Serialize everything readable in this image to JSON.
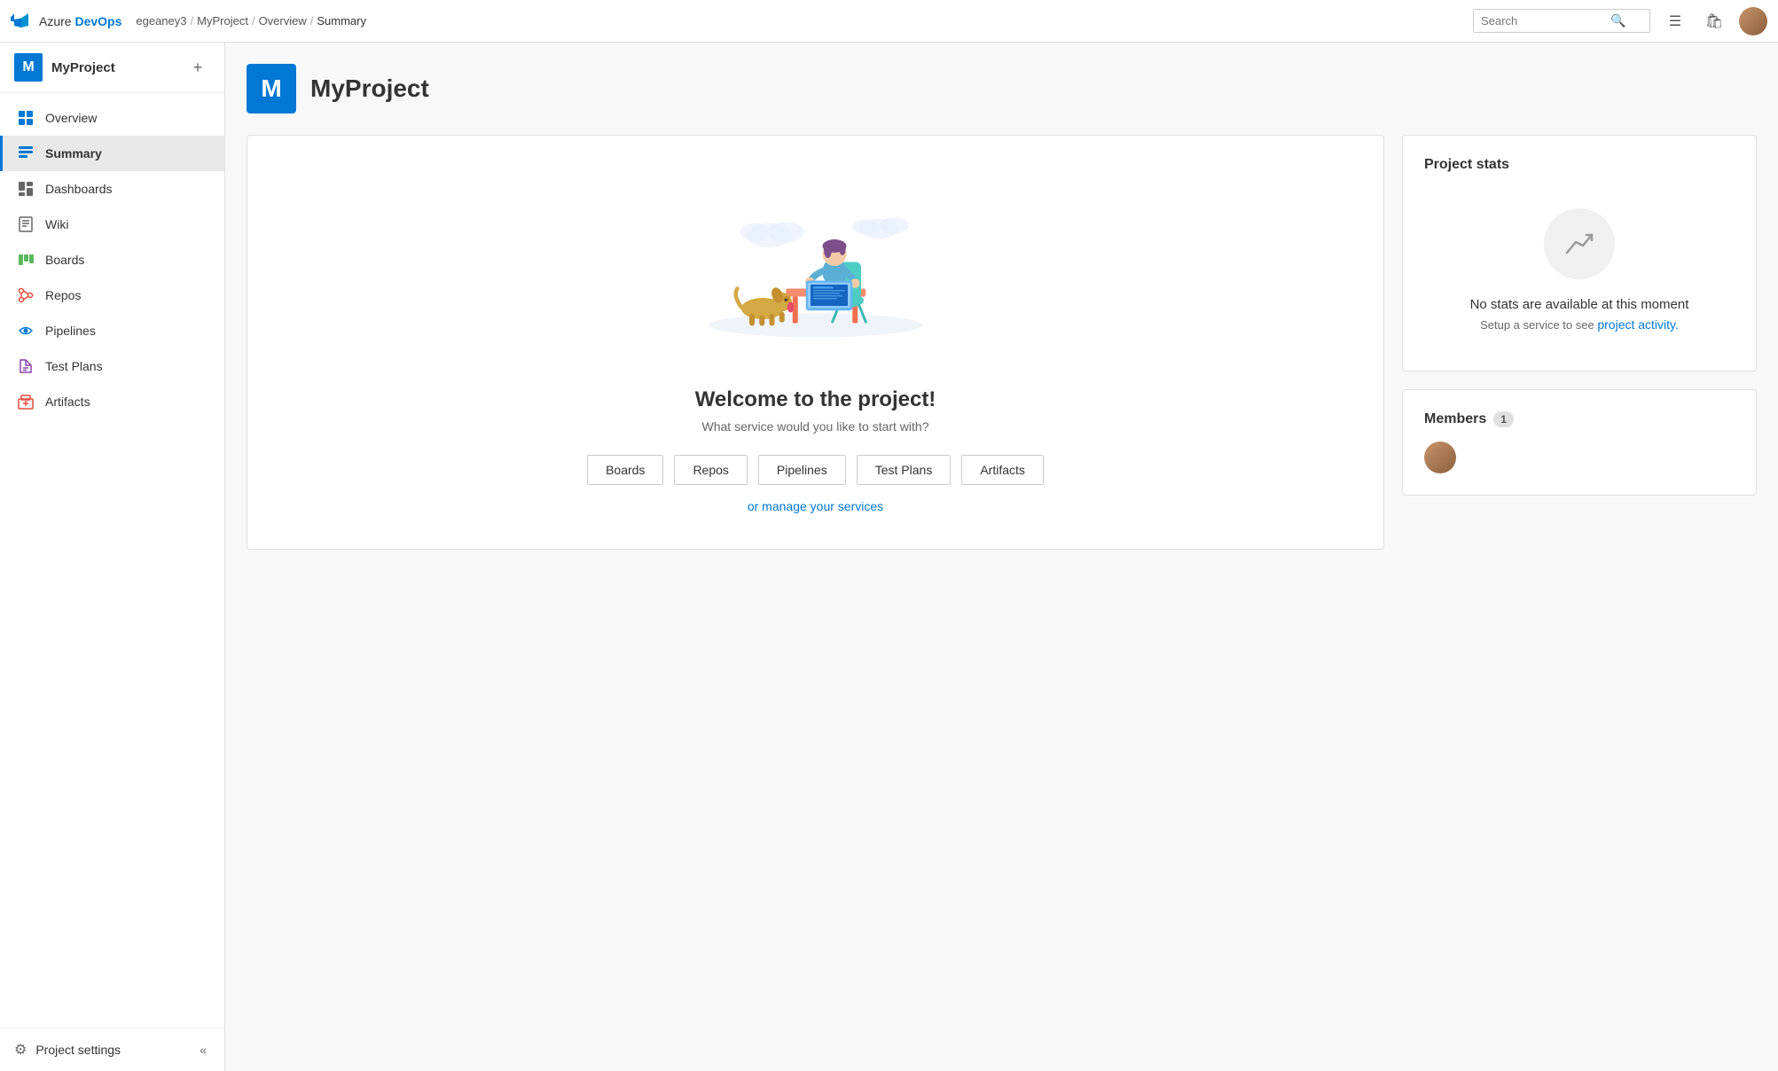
{
  "topNav": {
    "logo": {
      "text": "Azure ",
      "highlight": "DevOps"
    },
    "breadcrumb": [
      {
        "label": "egeaney3"
      },
      {
        "label": "MyProject"
      },
      {
        "label": "Overview"
      },
      {
        "label": "Summary"
      }
    ],
    "search": {
      "placeholder": "Search"
    }
  },
  "sidebar": {
    "project": {
      "initial": "M",
      "name": "MyProject"
    },
    "items": [
      {
        "id": "overview",
        "label": "Overview",
        "active": false
      },
      {
        "id": "summary",
        "label": "Summary",
        "active": true
      },
      {
        "id": "dashboards",
        "label": "Dashboards",
        "active": false
      },
      {
        "id": "wiki",
        "label": "Wiki",
        "active": false
      },
      {
        "id": "boards",
        "label": "Boards",
        "active": false
      },
      {
        "id": "repos",
        "label": "Repos",
        "active": false
      },
      {
        "id": "pipelines",
        "label": "Pipelines",
        "active": false
      },
      {
        "id": "testplans",
        "label": "Test Plans",
        "active": false
      },
      {
        "id": "artifacts",
        "label": "Artifacts",
        "active": false
      }
    ],
    "footer": {
      "settings": "Project settings"
    }
  },
  "projectHeader": {
    "initial": "M",
    "title": "MyProject"
  },
  "welcomeCard": {
    "title": "Welcome to the project!",
    "subtitle": "What service would you like to start with?",
    "buttons": [
      {
        "label": "Boards"
      },
      {
        "label": "Repos"
      },
      {
        "label": "Pipelines"
      },
      {
        "label": "Test Plans"
      },
      {
        "label": "Artifacts"
      }
    ],
    "manageLink": "or manage your services"
  },
  "statsCard": {
    "title": "Project stats",
    "emptyTitle": "No stats are available at this moment",
    "emptySubtext": "Setup a service to see ",
    "emptyLink": "project activity."
  },
  "membersCard": {
    "title": "Members",
    "count": "1"
  }
}
